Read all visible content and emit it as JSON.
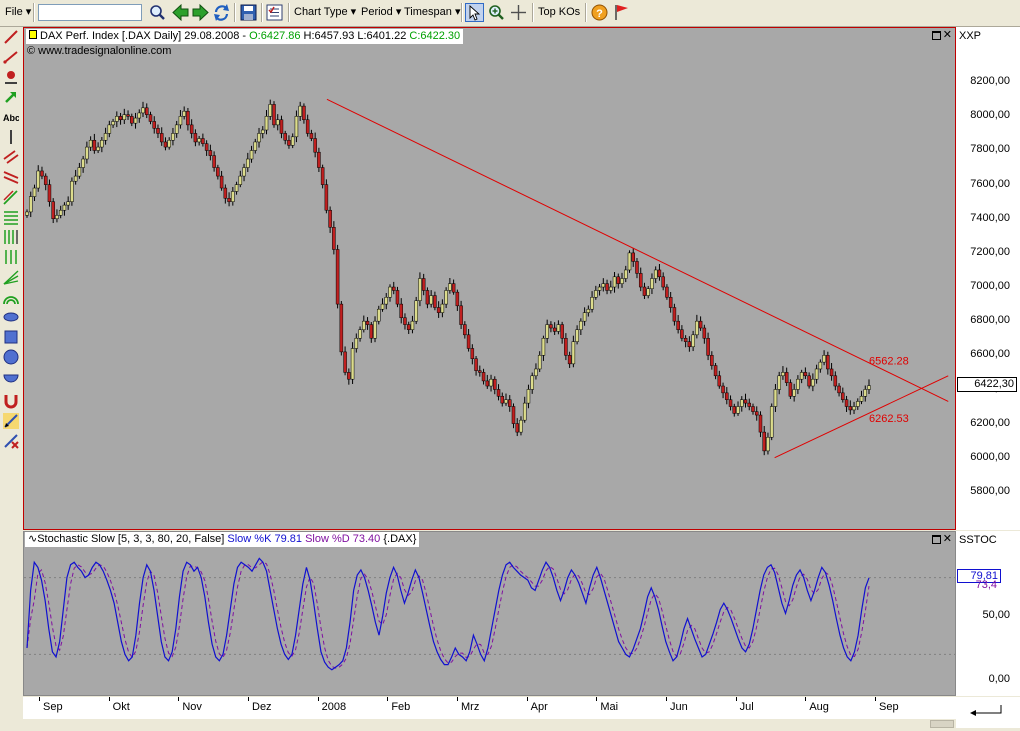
{
  "toolbar": {
    "file": "File",
    "chart_type": "Chart Type",
    "period": "Period",
    "timespan": "Timespan",
    "top_kos": "Top KOs"
  },
  "main_panel": {
    "symbol_header": "DAX Perf. Index [.DAX  Daily] 29.08.2008 - ",
    "open": "O:6427.86",
    "high": "H:6457.93",
    "low": "L:6401.22",
    "close": "C:6422.30",
    "copyright": "© www.tradesignalonline.com",
    "axis_title": "XXP",
    "price_tag": "6422,30"
  },
  "indicator_panel": {
    "name": "Stochastic Slow [5, 3, 3, 80, 20, False]",
    "k_label": "Slow %K 79.81",
    "d_label": "Slow %D 73.40",
    "symbol": "{.DAX}",
    "axis_title": "SSTOC",
    "k_tag": "79,81",
    "d_tag": "73,4"
  },
  "colors": {
    "up": "#dcdc8c",
    "down": "#c02020",
    "trend": "#e00000",
    "k": "#1010d0",
    "d": "#8010a0",
    "bg": "#a8a8a8"
  },
  "chart_data": [
    {
      "type": "candlestick",
      "title": "DAX Perf. Index [.DAX  Daily]",
      "x": {
        "labels": [
          "Sep",
          "Okt",
          "Nov",
          "Dez",
          "2008",
          "Feb",
          "Mrz",
          "Apr",
          "Mai",
          "Jun",
          "Jul",
          "Aug",
          "Sep"
        ]
      },
      "y_ticks": [
        "8200,00",
        "8000,00",
        "7800,00",
        "7600,00",
        "7400,00",
        "7200,00",
        "7000,00",
        "6800,00",
        "6600,00",
        "6400,00",
        "6200,00",
        "6000,00",
        "5800,00"
      ],
      "ylim": [
        5600,
        8500
      ],
      "series_close_daily": [
        7440,
        7530,
        7580,
        7680,
        7650,
        7600,
        7500,
        7400,
        7420,
        7450,
        7480,
        7500,
        7620,
        7650,
        7700,
        7750,
        7820,
        7860,
        7800,
        7820,
        7860,
        7900,
        7950,
        7970,
        8000,
        7980,
        8010,
        8000,
        7960,
        7990,
        8020,
        8050,
        8010,
        7970,
        7930,
        7900,
        7850,
        7820,
        7860,
        7900,
        7950,
        8000,
        8030,
        7950,
        7900,
        7850,
        7870,
        7840,
        7800,
        7770,
        7700,
        7650,
        7580,
        7520,
        7500,
        7560,
        7600,
        7650,
        7700,
        7750,
        7800,
        7850,
        7900,
        7920,
        8000,
        8070,
        7950,
        7980,
        7900,
        7860,
        7830,
        7880,
        8000,
        8060,
        7980,
        7900,
        7870,
        7790,
        7700,
        7600,
        7450,
        7350,
        7220,
        6900,
        6620,
        6500,
        6460,
        6640,
        6700,
        6750,
        6800,
        6780,
        6700,
        6800,
        6870,
        6900,
        6940,
        7000,
        6980,
        6900,
        6820,
        6780,
        6750,
        6800,
        6920,
        7050,
        6980,
        6900,
        6950,
        6880,
        6850,
        6900,
        6980,
        7020,
        6970,
        6890,
        6780,
        6720,
        6640,
        6580,
        6510,
        6500,
        6450,
        6420,
        6460,
        6400,
        6360,
        6320,
        6340,
        6300,
        6200,
        6150,
        6220,
        6320,
        6400,
        6480,
        6520,
        6600,
        6700,
        6780,
        6760,
        6740,
        6780,
        6700,
        6600,
        6550,
        6680,
        6750,
        6800,
        6850,
        6870,
        6940,
        6980,
        7000,
        7020,
        6980,
        7000,
        7060,
        7020,
        7050,
        7100,
        7200,
        7150,
        7080,
        7000,
        6950,
        6990,
        7050,
        7100,
        7060,
        7000,
        6940,
        6880,
        6800,
        6750,
        6700,
        6680,
        6650,
        6720,
        6800,
        6760,
        6700,
        6600,
        6540,
        6480,
        6420,
        6380,
        6340,
        6300,
        6260,
        6300,
        6340,
        6320,
        6300,
        6270,
        6250,
        6150,
        6040,
        6120,
        6300,
        6400,
        6480,
        6500,
        6440,
        6360,
        6400,
        6460,
        6500,
        6480,
        6420,
        6460,
        6520,
        6560,
        6600,
        6520,
        6480,
        6420,
        6380,
        6340,
        6300,
        6280,
        6300,
        6330,
        6360,
        6400,
        6422.3
      ],
      "annotations": [
        "6562.28",
        "6262.53"
      ],
      "trendlines": [
        {
          "from": {
            "date": "2008-01-02",
            "value": 8100
          },
          "to": {
            "date": "2008-09-30",
            "value": 6330
          }
        },
        {
          "from": {
            "date": "2008-07-16",
            "value": 6000
          },
          "to": {
            "date": "2008-09-30",
            "value": 6480
          }
        }
      ]
    },
    {
      "type": "line",
      "title": "Stochastic Slow [5, 3, 3, 80, 20, False]",
      "series": [
        {
          "name": "Slow %K",
          "last": 79.81
        },
        {
          "name": "Slow %D",
          "last": 73.4
        }
      ],
      "y_ticks": [
        "50,00",
        "0,00"
      ],
      "levels": [
        80,
        20
      ],
      "ylim": [
        0,
        100
      ],
      "k_values": [
        25,
        70,
        92,
        88,
        78,
        62,
        40,
        22,
        18,
        30,
        55,
        80,
        90,
        92,
        88,
        85,
        80,
        82,
        88,
        92,
        90,
        85,
        78,
        70,
        60,
        45,
        30,
        20,
        15,
        18,
        35,
        60,
        80,
        90,
        85,
        70,
        50,
        30,
        18,
        15,
        22,
        40,
        65,
        85,
        92,
        90,
        85,
        88,
        80,
        65,
        45,
        28,
        18,
        15,
        20,
        35,
        55,
        75,
        88,
        92,
        90,
        88,
        85,
        90,
        95,
        92,
        85,
        70,
        55,
        40,
        28,
        20,
        16,
        20,
        35,
        55,
        75,
        88,
        78,
        60,
        40,
        22,
        14,
        10,
        8,
        10,
        12,
        15,
        25,
        45,
        70,
        82,
        86,
        80,
        70,
        58,
        45,
        35,
        50,
        68,
        80,
        88,
        82,
        70,
        60,
        68,
        78,
        86,
        80,
        68,
        55,
        42,
        30,
        22,
        16,
        12,
        12,
        18,
        25,
        20,
        18,
        15,
        22,
        35,
        28,
        20,
        15,
        25,
        40,
        55,
        70,
        82,
        90,
        92,
        88,
        85,
        82,
        80,
        78,
        72,
        70,
        78,
        86,
        92,
        88,
        80,
        70,
        62,
        70,
        80,
        86,
        82,
        76,
        68,
        60,
        72,
        82,
        88,
        80,
        70,
        60,
        50,
        40,
        30,
        25,
        20,
        18,
        24,
        32,
        40,
        52,
        65,
        72,
        65,
        55,
        42,
        30,
        22,
        15,
        18,
        28,
        40,
        48,
        40,
        32,
        25,
        18,
        20,
        28,
        36,
        45,
        55,
        60,
        55,
        48,
        40,
        32,
        25,
        22,
        28,
        40,
        55,
        70,
        82,
        88,
        90,
        84,
        72,
        60,
        52,
        62,
        74,
        82,
        86,
        80,
        70,
        62,
        70,
        80,
        88,
        84,
        74,
        62,
        48,
        35,
        25,
        18,
        15,
        22,
        35,
        55,
        72,
        79.81
      ]
    }
  ]
}
